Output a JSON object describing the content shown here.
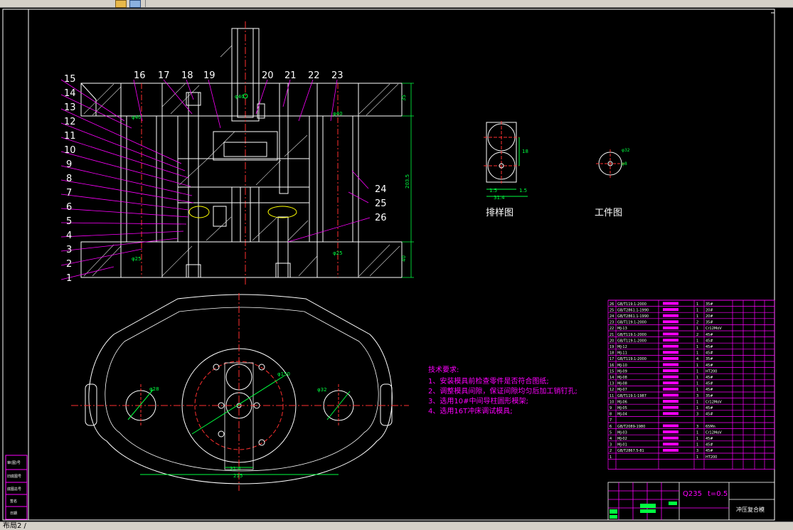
{
  "tab": {
    "label": "布局2 /"
  },
  "part_numbers_left": [
    "15",
    "14",
    "13",
    "12",
    "11",
    "10",
    "9",
    "8",
    "7",
    "6",
    "5",
    "4",
    "3",
    "2",
    "1"
  ],
  "part_numbers_top": [
    "16",
    "17",
    "18",
    "19",
    "20",
    "21",
    "22",
    "23"
  ],
  "part_numbers_right": [
    "24",
    "25",
    "26"
  ],
  "dims": {
    "top_height": "35",
    "total_height": "203.5",
    "bottom_height": "40",
    "bore_top_left": "φ40",
    "bore_top_right": "φ40",
    "bore_bottom_left": "φ25",
    "bore_bottom_right": "φ25",
    "center_label": "φ40"
  },
  "layout_drawing": {
    "caption": "排样图",
    "d1": "18",
    "d2": "1.5",
    "d3": "31.4",
    "d4": "1.5"
  },
  "workpiece": {
    "caption": "工件图",
    "d1": "φ32",
    "d2": "φ8"
  },
  "plan_view": {
    "d_left": "φ28",
    "d_right": "φ32",
    "d_center": "φ150",
    "w1": "31.4",
    "w2": "215"
  },
  "tech": {
    "title": "技术要求:",
    "lines": [
      "1、安装模具前检查零件是否符合图纸;",
      "2、调整模具间隙，保证间隙均匀后加工销钉孔;",
      "3、选用10#中间导柱圆形模架;",
      "4、选用16T冲床调试模具;"
    ]
  },
  "bom_rows": [
    {
      "no": "26",
      "code": "GB/T119.1-2000",
      "qty": "1",
      "mat": "35#"
    },
    {
      "no": "25",
      "code": "GB/T2861.1-1990",
      "qty": "1",
      "mat": "20#"
    },
    {
      "no": "24",
      "code": "GB/T2861.1-1990",
      "qty": "1",
      "mat": "20#"
    },
    {
      "no": "23",
      "code": "GB/T119.1-2000",
      "qty": "2",
      "mat": "35#"
    },
    {
      "no": "22",
      "code": "MJ-13",
      "qty": "1",
      "mat": "Cr12MoV"
    },
    {
      "no": "21",
      "code": "GB/T119.1-2000",
      "qty": "2",
      "mat": "45#"
    },
    {
      "no": "20",
      "code": "GB/T119.1-2000",
      "qty": "1",
      "mat": "45#"
    },
    {
      "no": "19",
      "code": "MJ-12",
      "qty": "1",
      "mat": "45#"
    },
    {
      "no": "18",
      "code": "MJ-11",
      "qty": "1",
      "mat": "45#"
    },
    {
      "no": "17",
      "code": "GB/T119.1-2000",
      "qty": "4",
      "mat": "35#"
    },
    {
      "no": "16",
      "code": "MJ-10",
      "qty": "1",
      "mat": "45#"
    },
    {
      "no": "15",
      "code": "MJ-09",
      "qty": "1",
      "mat": "HT200"
    },
    {
      "no": "14",
      "code": "MJ-08",
      "qty": "1",
      "mat": "45#"
    },
    {
      "no": "13",
      "code": "MJ-08",
      "qty": "1",
      "mat": "45#"
    },
    {
      "no": "12",
      "code": "MJ-07",
      "qty": "1",
      "mat": "45#"
    },
    {
      "no": "11",
      "code": "GB/T119.1-1987",
      "qty": "3",
      "mat": "35#"
    },
    {
      "no": "10",
      "code": "MJ-06",
      "qty": "1",
      "mat": "Cr12MoV"
    },
    {
      "no": "9",
      "code": "MJ-05",
      "qty": "1",
      "mat": "45#"
    },
    {
      "no": "8",
      "code": "MJ-04",
      "qty": "3",
      "mat": "45#"
    },
    {
      "no": "7",
      "code": "",
      "qty": "",
      "mat": ""
    },
    {
      "no": "6",
      "code": "GB/T2089-1980",
      "qty": "3",
      "mat": "65Mn"
    },
    {
      "no": "5",
      "code": "MJ-03",
      "qty": "1",
      "mat": "Cr12MoV"
    },
    {
      "no": "4",
      "code": "MJ-02",
      "qty": "1",
      "mat": "45#"
    },
    {
      "no": "3",
      "code": "MJ-01",
      "qty": "1",
      "mat": "45#"
    },
    {
      "no": "2",
      "code": "GB/T2867.5-81",
      "qty": "3",
      "mat": "45#"
    },
    {
      "no": "1",
      "code": "",
      "qty": "1",
      "mat": "HT200"
    }
  ],
  "title_block": {
    "material": "Q235",
    "thickness": "t=0.5",
    "name": "冲压复合模"
  },
  "left_strip": [
    "审(图)号",
    "旧底图号",
    "底图总号",
    "签名",
    "日期"
  ],
  "colors": {
    "line": "#ffffff",
    "red": "#ff3030",
    "green": "#00ff40",
    "magenta": "#ff00ff",
    "cyan": "#00ffff",
    "yellow": "#ffff00"
  }
}
